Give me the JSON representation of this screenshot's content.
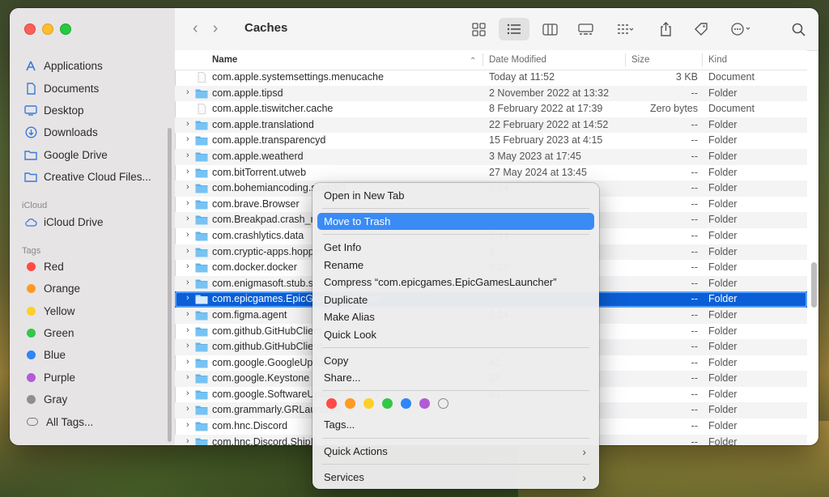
{
  "window": {
    "title": "Caches"
  },
  "sidebar": {
    "items_top": [
      {
        "label": "Applications",
        "icon": "applications-icon"
      },
      {
        "label": "Documents",
        "icon": "document-icon"
      },
      {
        "label": "Desktop",
        "icon": "desktop-icon"
      },
      {
        "label": "Downloads",
        "icon": "download-icon"
      },
      {
        "label": "Google Drive",
        "icon": "folder-icon"
      },
      {
        "label": "Creative Cloud Files...",
        "icon": "folder-icon"
      }
    ],
    "icloud_heading": "iCloud",
    "icloud_drive": "iCloud Drive",
    "tags_heading": "Tags",
    "tags": [
      {
        "label": "Red",
        "color": "#ff4b45"
      },
      {
        "label": "Orange",
        "color": "#ff9a22"
      },
      {
        "label": "Yellow",
        "color": "#ffd024"
      },
      {
        "label": "Green",
        "color": "#33c748"
      },
      {
        "label": "Blue",
        "color": "#2f86f6"
      },
      {
        "label": "Purple",
        "color": "#b25bd6"
      },
      {
        "label": "Gray",
        "color": "#8e8e93"
      }
    ],
    "all_tags": "All Tags..."
  },
  "columns": {
    "name": "Name",
    "date": "Date Modified",
    "size": "Size",
    "kind": "Kind"
  },
  "rows": [
    {
      "name": "com.apple.systemsettings.menucache",
      "date": "Today at 11:52",
      "size": "3 KB",
      "kind": "Document",
      "type": "doc"
    },
    {
      "name": "com.apple.tipsd",
      "date": "2 November 2022 at 13:32",
      "size": "--",
      "kind": "Folder",
      "type": "folder"
    },
    {
      "name": "com.apple.tiswitcher.cache",
      "date": "8 February 2022 at 17:39",
      "size": "Zero bytes",
      "kind": "Document",
      "type": "doc"
    },
    {
      "name": "com.apple.translationd",
      "date": "22 February 2022 at 14:52",
      "size": "--",
      "kind": "Folder",
      "type": "folder"
    },
    {
      "name": "com.apple.transparencyd",
      "date": "15 February 2023 at 4:15",
      "size": "--",
      "kind": "Folder",
      "type": "folder"
    },
    {
      "name": "com.apple.weatherd",
      "date": "3 May 2023 at 17:45",
      "size": "--",
      "kind": "Folder",
      "type": "folder"
    },
    {
      "name": "com.bitTorrent.utweb",
      "date": "27 May 2024 at 13:45",
      "size": "--",
      "kind": "Folder",
      "type": "folder"
    },
    {
      "name": "com.bohemiancoding.sketch3",
      "date": "3:14",
      "size": "--",
      "kind": "Folder",
      "type": "folder"
    },
    {
      "name": "com.brave.Browser",
      "date": "",
      "size": "--",
      "kind": "Folder",
      "type": "folder"
    },
    {
      "name": "com.Breakpad.crash_report",
      "date": "",
      "size": "--",
      "kind": "Folder",
      "type": "folder"
    },
    {
      "name": "com.crashlytics.data",
      "date": "2:44",
      "size": "--",
      "kind": "Folder",
      "type": "folder"
    },
    {
      "name": "com.cryptic-apps.hopper",
      "date": "3",
      "size": "--",
      "kind": "Folder",
      "type": "folder"
    },
    {
      "name": "com.docker.docker",
      "date": "9:28",
      "size": "--",
      "kind": "Folder",
      "type": "folder"
    },
    {
      "name": "com.enigmasoft.stub.s",
      "date": "",
      "size": "--",
      "kind": "Folder",
      "type": "folder"
    },
    {
      "name": "com.epicgames.EpicGamesLauncher",
      "date": "",
      "size": "--",
      "kind": "Folder",
      "type": "folder",
      "selected": true
    },
    {
      "name": "com.figma.agent",
      "date": "3:24",
      "size": "--",
      "kind": "Folder",
      "type": "folder"
    },
    {
      "name": "com.github.GitHubClient",
      "date": "",
      "size": "--",
      "kind": "Folder",
      "type": "folder"
    },
    {
      "name": "com.github.GitHubClient",
      "date": "",
      "size": "--",
      "kind": "Folder",
      "type": "folder"
    },
    {
      "name": "com.google.GoogleUpdater",
      "date": "41",
      "size": "--",
      "kind": "Folder",
      "type": "folder"
    },
    {
      "name": "com.google.Keystone",
      "date": "28",
      "size": "--",
      "kind": "Folder",
      "type": "folder"
    },
    {
      "name": "com.google.SoftwareUpdate",
      "date": "53",
      "size": "--",
      "kind": "Folder",
      "type": "folder"
    },
    {
      "name": "com.grammarly.GRLauncher",
      "date": "",
      "size": "--",
      "kind": "Folder",
      "type": "folder"
    },
    {
      "name": "com.hnc.Discord",
      "date": "",
      "size": "--",
      "kind": "Folder",
      "type": "folder"
    },
    {
      "name": "com.hnc.Discord.ShipIt",
      "date": "",
      "size": "--",
      "kind": "Folder",
      "type": "folder"
    }
  ],
  "menu": {
    "open_new_tab": "Open in New Tab",
    "move_to_trash": "Move to Trash",
    "get_info": "Get Info",
    "rename": "Rename",
    "compress": "Compress “com.epicgames.EpicGamesLauncher”",
    "duplicate": "Duplicate",
    "make_alias": "Make Alias",
    "quick_look": "Quick Look",
    "copy": "Copy",
    "share": "Share...",
    "tag_colors": [
      "#ff4b45",
      "#ff9a22",
      "#ffd024",
      "#33c748",
      "#2f86f6",
      "#b25bd6"
    ],
    "tags": "Tags...",
    "quick_actions": "Quick Actions",
    "services": "Services"
  }
}
